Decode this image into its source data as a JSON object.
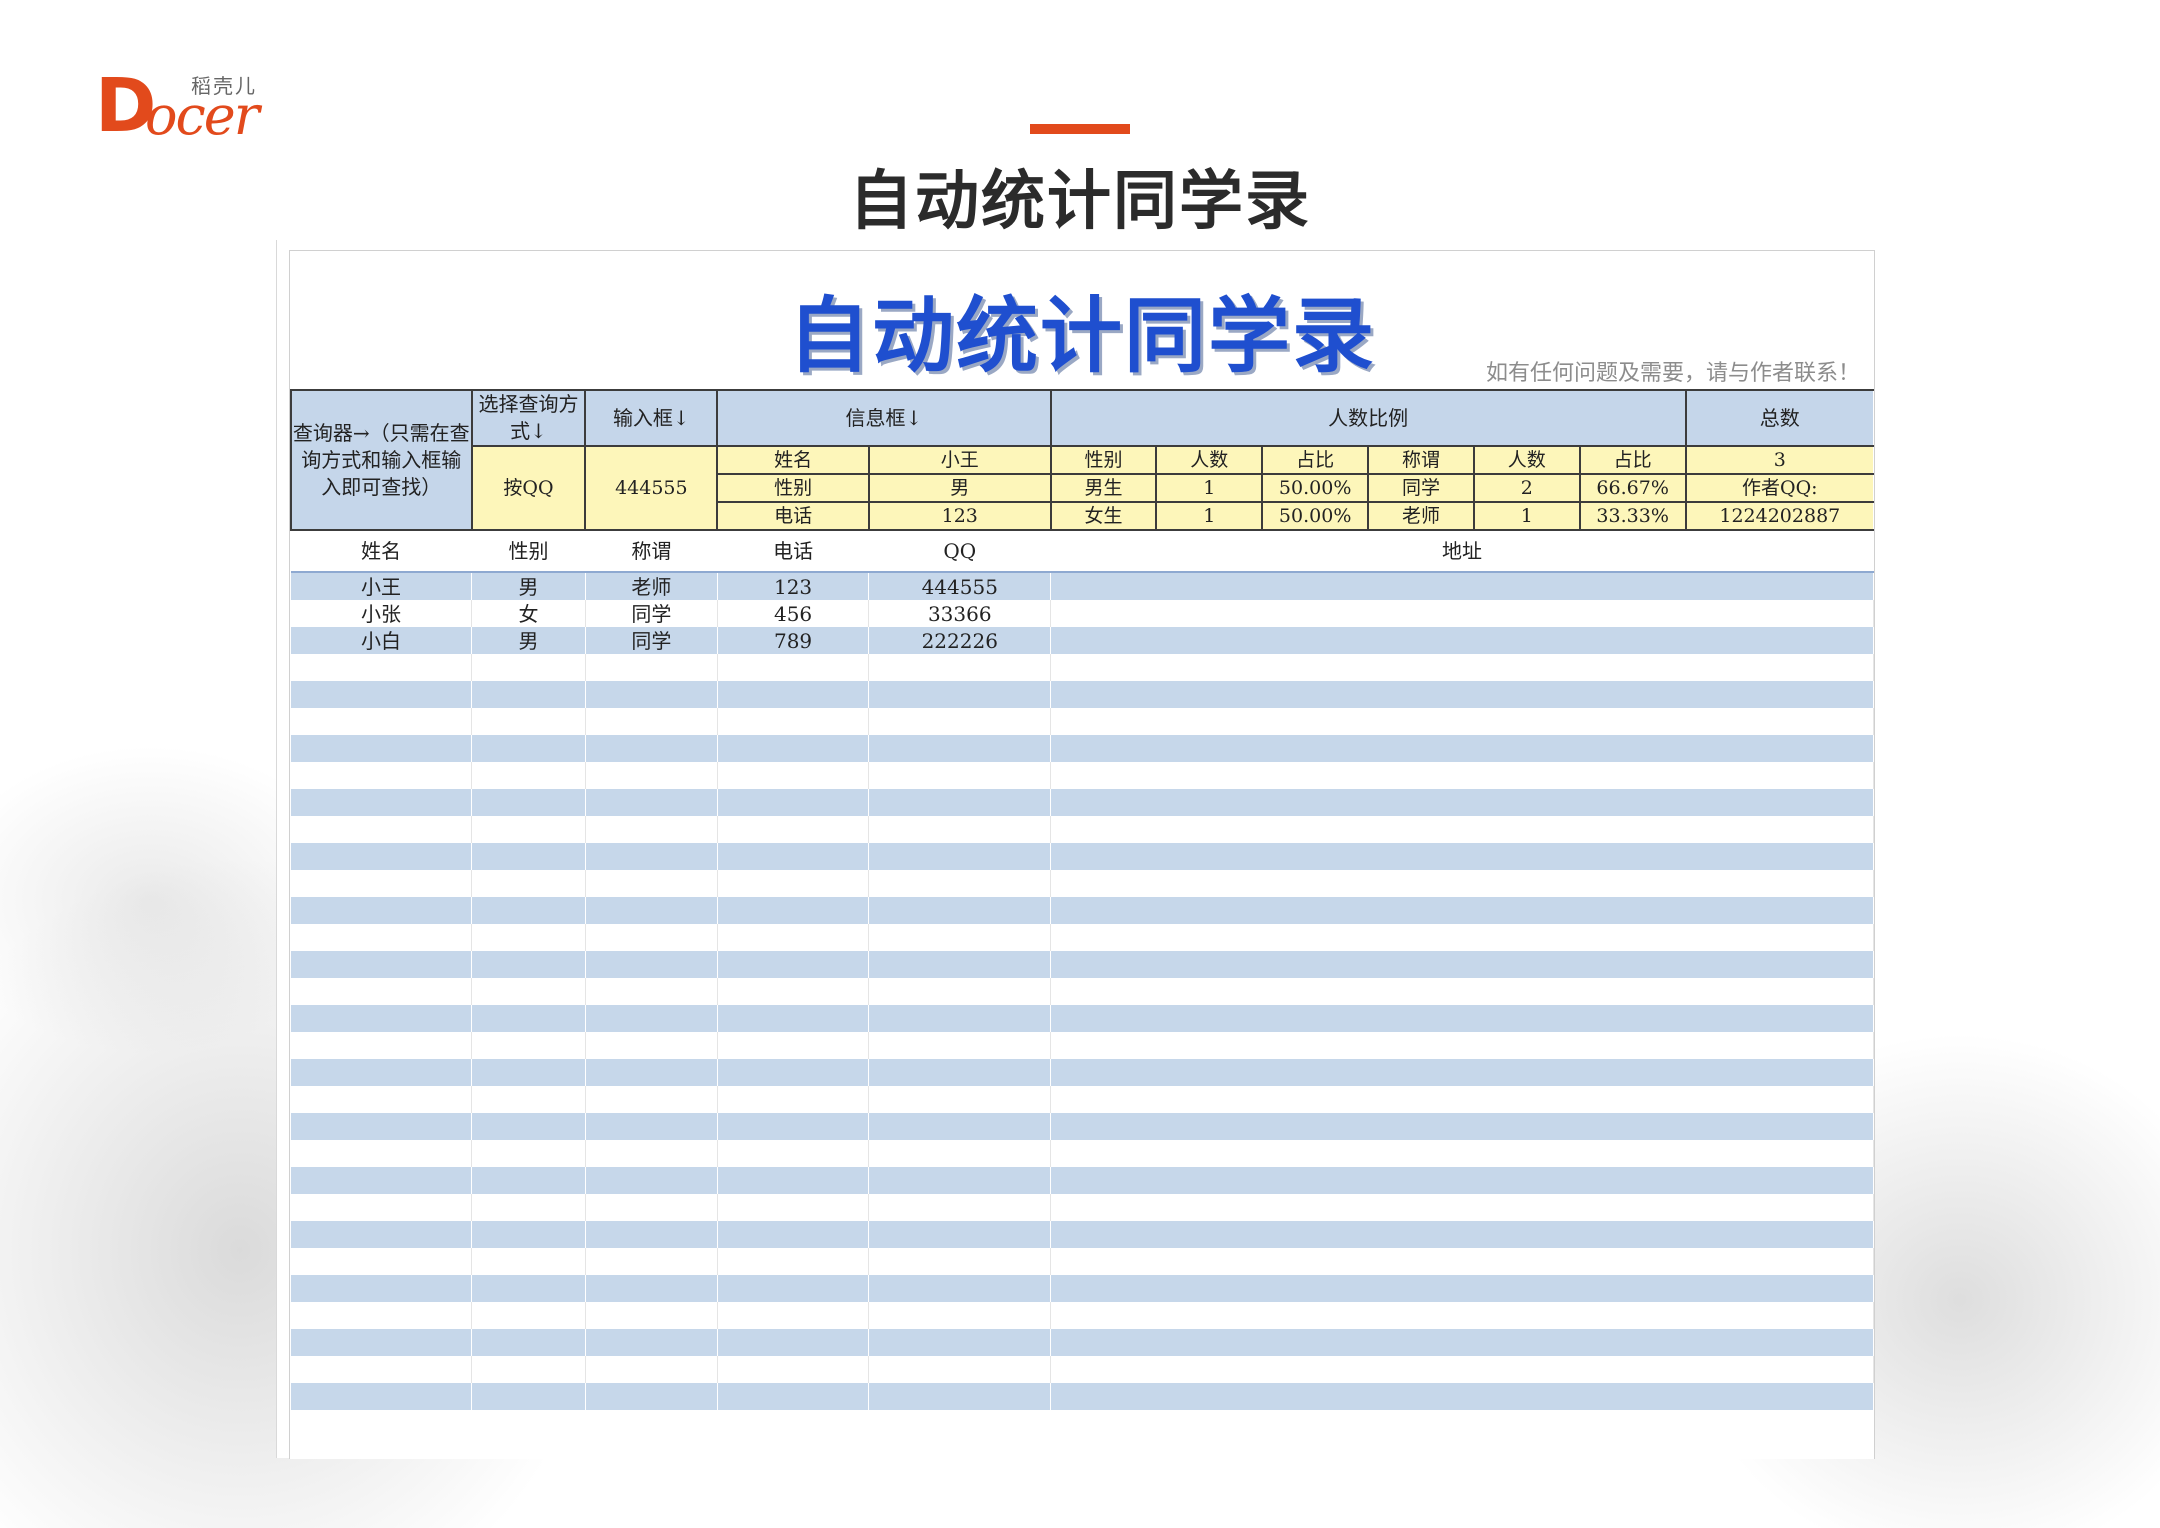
{
  "logo": {
    "brand_cn": "稻壳儿",
    "mark": "D",
    "text": "ocer"
  },
  "slide": {
    "title": "自动统计同学录"
  },
  "sheet": {
    "title": "自动统计同学录",
    "contact_note": "如有任何问题及需要，请与作者联系！",
    "header": {
      "query_label": "查询器→（只需在查询方式和输入框输入即可查找）",
      "select_mode_label": "选择查询方式↓",
      "input_box_label": "输入框↓",
      "info_box_label": "信息框↓",
      "ratio_label": "人数比例",
      "total_label": "总数"
    },
    "query": {
      "mode": "按QQ",
      "input": "444555"
    },
    "info": [
      {
        "key": "姓名",
        "value": "小王"
      },
      {
        "key": "性别",
        "value": "男"
      },
      {
        "key": "电话",
        "value": "123"
      }
    ],
    "ratio": {
      "gender_headers": [
        "性别",
        "人数",
        "占比"
      ],
      "gender_rows": [
        {
          "label": "男生",
          "count": "1",
          "pct": "50.00%"
        },
        {
          "label": "女生",
          "count": "1",
          "pct": "50.00%"
        }
      ],
      "title_headers": [
        "称谓",
        "人数",
        "占比"
      ],
      "title_rows": [
        {
          "label": "同学",
          "count": "2",
          "pct": "66.67%"
        },
        {
          "label": "老师",
          "count": "1",
          "pct": "33.33%"
        }
      ]
    },
    "total": {
      "count": "3",
      "author_label": "作者QQ:",
      "author_qq": "1224202887"
    },
    "columns": [
      "姓名",
      "性别",
      "称谓",
      "电话",
      "QQ",
      "地址"
    ],
    "rows": [
      [
        "小王",
        "男",
        "老师",
        "123",
        "444555",
        ""
      ],
      [
        "小张",
        "女",
        "同学",
        "456",
        "33366",
        ""
      ],
      [
        "小白",
        "男",
        "同学",
        "789",
        "222226",
        ""
      ]
    ]
  }
}
